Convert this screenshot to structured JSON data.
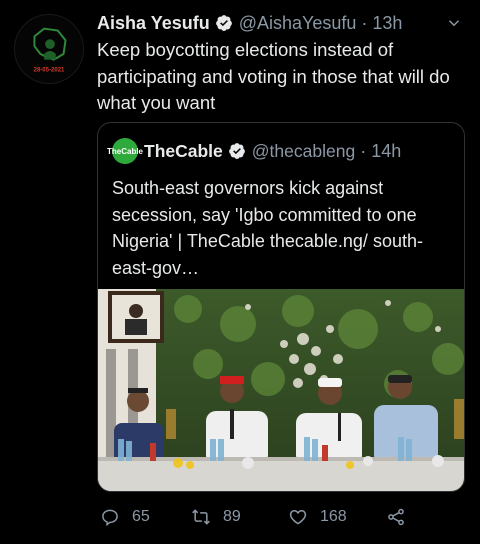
{
  "tweet": {
    "display_name": "Aisha Yesufu",
    "handle": "@AishaYesufu",
    "separator": "·",
    "time": "13h",
    "text": "Keep boycotting elections instead of participating and voting in those that will do what you want",
    "avatar_date": "28-05-2021"
  },
  "quoted": {
    "avatar_label": "TheCable",
    "display_name": "TheCable",
    "handle": "@thecableng",
    "separator": "·",
    "time": "14h",
    "text": "South-east governors kick against secession, say 'Igbo committed to one Nigeria' | TheCable thecable.ng/ south-east-gov…"
  },
  "actions": {
    "replies": "65",
    "retweets": "89",
    "likes": "168"
  },
  "colors": {
    "background": "#000000",
    "muted": "#8b98a5",
    "verified": "#e7e9ea",
    "cable_green": "#2eaa3c"
  },
  "icons": [
    "verified-icon",
    "more-icon",
    "reply-icon",
    "retweet-icon",
    "like-icon",
    "share-icon"
  ]
}
